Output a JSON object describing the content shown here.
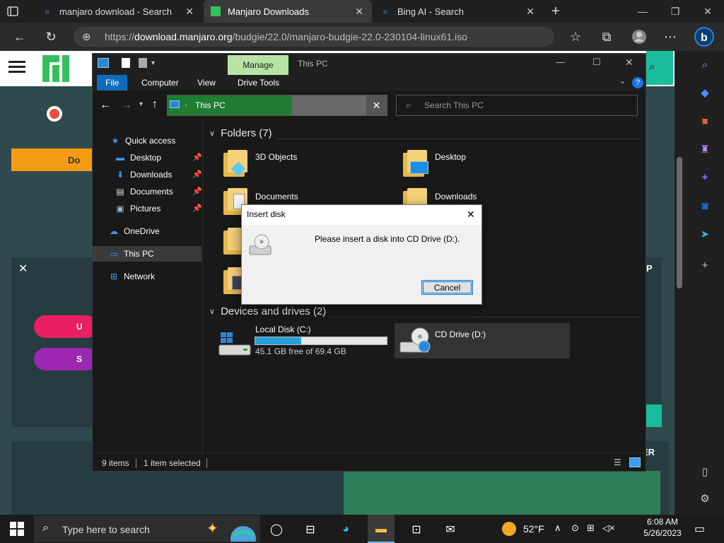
{
  "browser": {
    "tabs": [
      {
        "label": "manjaro download - Search",
        "active": false
      },
      {
        "label": "Manjaro Downloads",
        "active": true
      },
      {
        "label": "Bing AI - Search",
        "active": false
      }
    ],
    "new_tab": "+",
    "url_prefix": "https://",
    "url_domain": "download.manjaro.org",
    "url_path": "/budgie/22.0/manjaro-budgie-22.0-230104-linux61.iso"
  },
  "webpage": {
    "download_label": "Do",
    "btn1": "U",
    "btn2": "S",
    "side_text1": "P",
    "side_text2": "ER",
    "close": "✕"
  },
  "explorer": {
    "title": "This PC",
    "manage": "Manage",
    "ribbon_tabs": [
      "File",
      "Computer",
      "View",
      "Drive Tools"
    ],
    "address": "This PC",
    "search_placeholder": "Search This PC",
    "nav": {
      "quick_access": "Quick access",
      "desktop": "Desktop",
      "downloads": "Downloads",
      "documents": "Documents",
      "pictures": "Pictures",
      "onedrive": "OneDrive",
      "this_pc": "This PC",
      "network": "Network"
    },
    "folders_header": "Folders (7)",
    "folders": {
      "f1": "3D Objects",
      "f2": "Desktop",
      "f3": "Documents",
      "f4": "Downloads"
    },
    "devices_header": "Devices and drives (2)",
    "local_disk": {
      "name": "Local Disk (C:)",
      "free": "45.1 GB free of 69.4 GB",
      "used_fraction": 0.35
    },
    "cd_drive": {
      "name": "CD Drive (D:)"
    },
    "status_items": "9 items",
    "status_selected": "1 item selected"
  },
  "dialog": {
    "title": "Insert disk",
    "message": "Please insert a disk into CD Drive (D:).",
    "cancel": "Cancel",
    "close": "✕"
  },
  "taskbar": {
    "search_placeholder": "Type here to search",
    "weather": "52°F",
    "time": "6:08 AM",
    "date": "5/26/2023"
  }
}
